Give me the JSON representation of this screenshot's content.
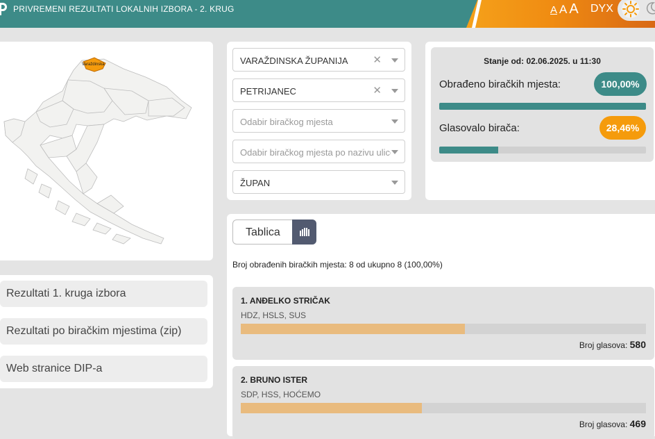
{
  "header": {
    "title": "PRIVREMENI REZULTATI LOKALNIH IZBORA - 2. KRUG",
    "font_small": "A",
    "font_medium": "A",
    "font_large": "A",
    "dyslexic_label": "DYX",
    "colors": {
      "teal": "#3d8b88",
      "orange": "#f59b0c"
    }
  },
  "map": {
    "highlight_label": "Varaždinska"
  },
  "links": [
    {
      "label": "Rezultati 1. kruga izbora"
    },
    {
      "label": "Rezultati po biračkim mjestima (zip)"
    },
    {
      "label": "Web stranice DIP-a"
    }
  ],
  "filters": {
    "county": "VARAŽDINSKA ŽUPANIJA",
    "municipality": "PETRIJANEC",
    "polling_station_placeholder": "Odabir biračkog mjesta",
    "street_placeholder": "Odabir biračkog mjesta po nazivu ulice",
    "election_type": "ŽUPAN"
  },
  "stats": {
    "status_label": "Stanje od: 02.06.2025. u 11:30",
    "processed_label": "Obrađeno biračkih mjesta:",
    "processed_value": "100,00%",
    "processed_fraction": 1.0,
    "turnout_label": "Glasovalo birača:",
    "turnout_value": "28,46%",
    "turnout_fraction": 0.2846
  },
  "results": {
    "table_tab": "Tablica",
    "processed_text": "Broj obrađenih biračkih mjesta: 8 od ukupno 8 (100,00%)",
    "votes_label": "Broj glasova:",
    "candidates": [
      {
        "name": "1. ANĐELKO STRIČAK",
        "parties": "HDZ, HSLS, SUS",
        "votes": "580",
        "share": 0.5529
      },
      {
        "name": "2. BRUNO ISTER",
        "parties": "SDP, HSS, HOĆEMO",
        "votes": "469",
        "share": 0.4471
      }
    ]
  }
}
